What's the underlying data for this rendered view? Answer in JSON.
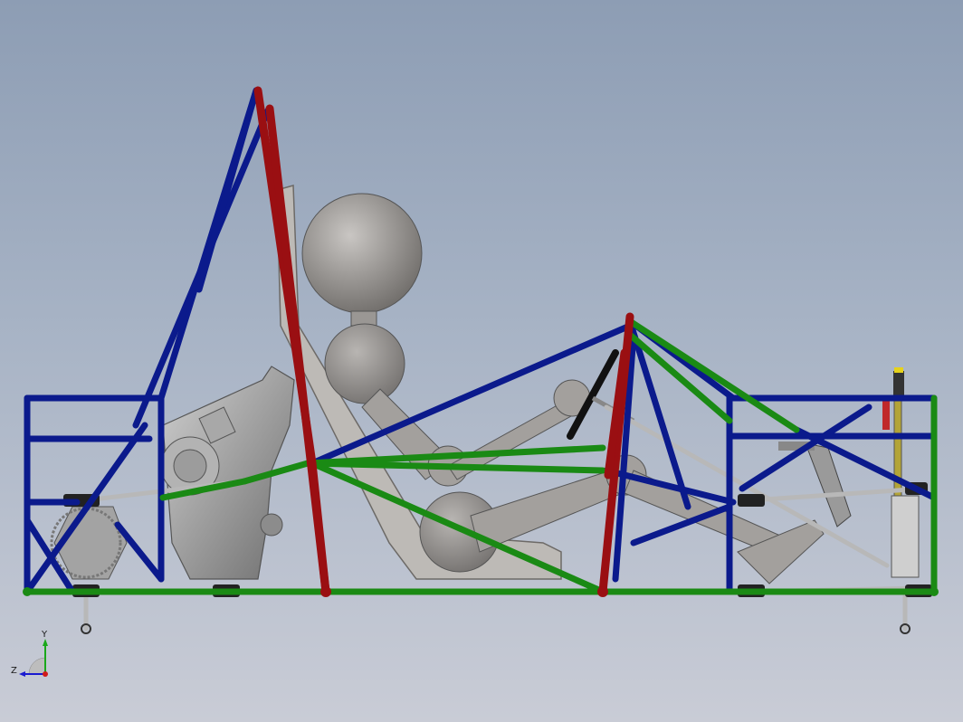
{
  "viewport": {
    "background_top": "#8d9db4",
    "background_bottom": "#c9ccd6"
  },
  "model": {
    "frame_colors": {
      "main_hoop": "#9a0f12",
      "side_members": "#0b1a8c",
      "diagonal_bracing": "#1a8a14",
      "components": "#8a8a8a"
    },
    "parts": [
      "main-hoop",
      "front-hoop",
      "rear-bay",
      "front-bay",
      "engine",
      "driver-dummy",
      "seat",
      "steering-wheel",
      "pedal-box",
      "suspension"
    ]
  },
  "triad": {
    "y_label": "Y",
    "z_label": "Z",
    "icon": "reference-triad-icon"
  }
}
